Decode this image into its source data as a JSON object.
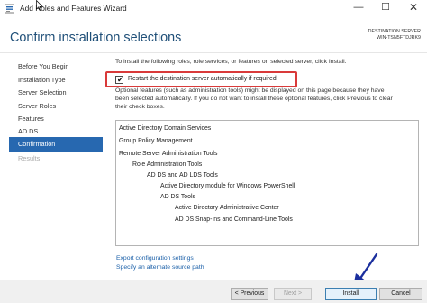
{
  "window": {
    "title": "Add Roles and Features Wizard",
    "minimize": "—",
    "maximize": "☐",
    "close": "✕"
  },
  "header": {
    "title": "Confirm installation selections",
    "destination_label": "DESTINATION SERVER",
    "destination_server": "WIN-TSN5FTDJRK9"
  },
  "sidebar": {
    "items": [
      {
        "label": "Before You Begin",
        "state": "normal"
      },
      {
        "label": "Installation Type",
        "state": "normal"
      },
      {
        "label": "Server Selection",
        "state": "normal"
      },
      {
        "label": "Server Roles",
        "state": "normal"
      },
      {
        "label": "Features",
        "state": "normal"
      },
      {
        "label": "AD DS",
        "state": "normal"
      },
      {
        "label": "Confirmation",
        "state": "selected"
      },
      {
        "label": "Results",
        "state": "disabled"
      }
    ]
  },
  "content": {
    "intro": "To install the following roles, role services, or features on selected server, click Install.",
    "restart_label": "Restart the destination server automatically if required",
    "restart_checked": true,
    "optional_lines": [
      "Optional features (such as administration tools) might be displayed on this page because they have",
      "been selected automatically. If you do not want to install these optional features, click Previous to clear",
      "their check boxes."
    ],
    "features": [
      {
        "label": "Active Directory Domain Services",
        "level": 0
      },
      {
        "label": "Group Policy Management",
        "level": 0
      },
      {
        "label": "Remote Server Administration Tools",
        "level": 0
      },
      {
        "label": "Role Administration Tools",
        "level": 1
      },
      {
        "label": "AD DS and AD LDS Tools",
        "level": 2
      },
      {
        "label": "Active Directory module for Windows PowerShell",
        "level": 3
      },
      {
        "label": "AD DS Tools",
        "level": 3
      },
      {
        "label": "Active Directory Administrative Center",
        "level": 4
      },
      {
        "label": "AD DS Snap-Ins and Command-Line Tools",
        "level": 4
      }
    ],
    "links": {
      "export": "Export configuration settings",
      "alternate_source": "Specify an alternate source path"
    }
  },
  "footer": {
    "previous": "< Previous",
    "next": "Next >",
    "install": "Install",
    "cancel": "Cancel"
  },
  "colors": {
    "accent": "#2768b0",
    "title": "#1f4f78",
    "link": "#1a5fa8",
    "highlight": "#d93a3a",
    "arrow": "#1b2f9e"
  },
  "icons": {
    "app": "server-manager-icon",
    "arrow": "annotation-arrow-icon",
    "cursor": "mouse-cursor-icon"
  }
}
